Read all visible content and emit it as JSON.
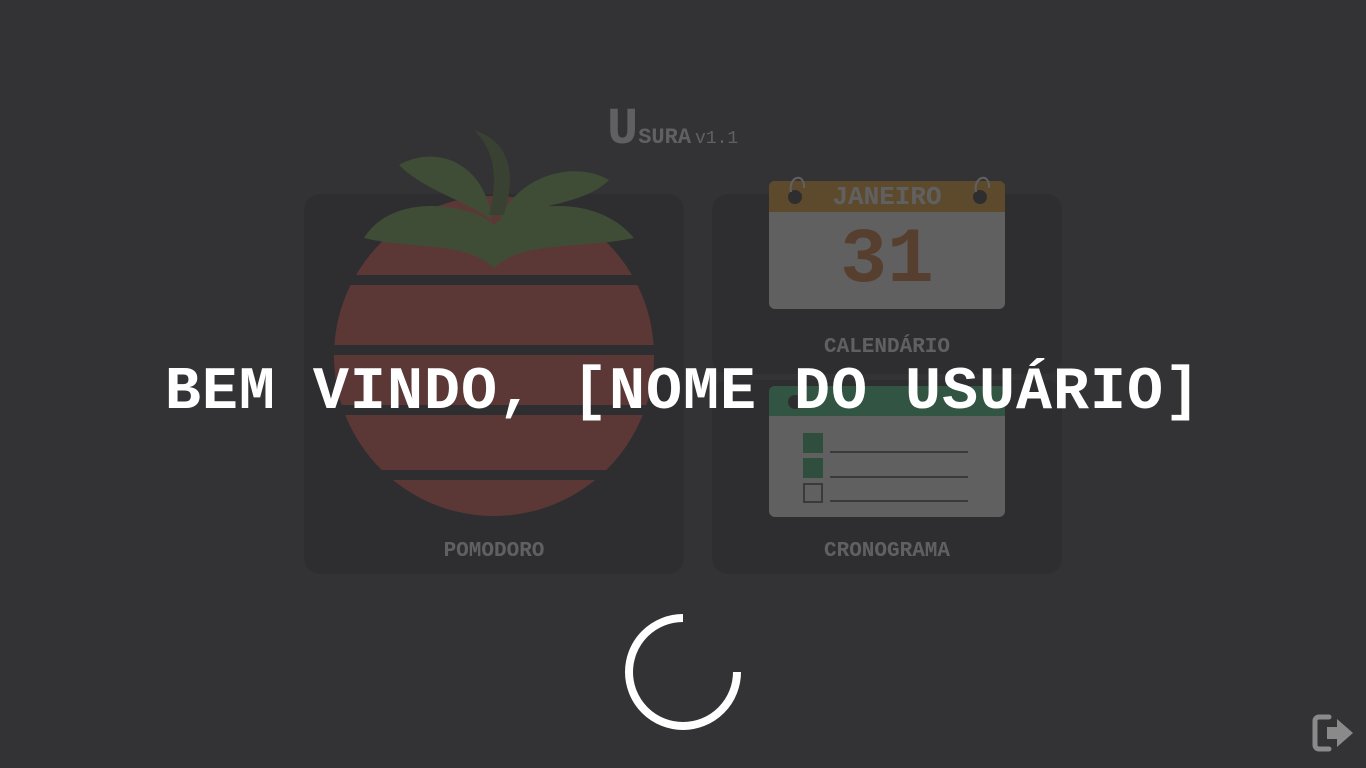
{
  "app": {
    "title_initial": "U",
    "title_rest": "SURA",
    "version": "v1.1"
  },
  "cards": {
    "pomodoro": {
      "label": "POMODORO"
    },
    "calendar": {
      "label": "CALENDÁRIO",
      "month": "JANEIRO",
      "day": "31"
    },
    "cronograma": {
      "label": "CRONOGRAMA"
    }
  },
  "overlay": {
    "welcome_text": "BEM VINDO, [NOME DO USUÁRIO]",
    "spinner_icon": "loading-spinner-icon",
    "logout_icon": "logout-icon"
  },
  "colors": {
    "background": "#333335",
    "tomato": "#c0392b",
    "leaf": "#4f7a2a",
    "calendar_header": "#e8823a",
    "calendar_day": "#d96b1c",
    "checklist_header": "#27ae60",
    "text": "#ffffff"
  }
}
